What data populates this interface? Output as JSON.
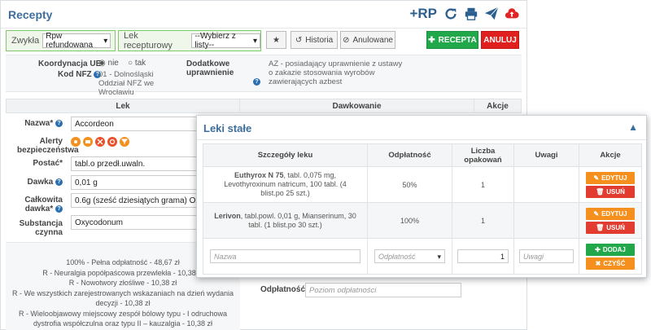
{
  "header": {
    "title": "Recepty",
    "rp_label": "+RP"
  },
  "toolbar": {
    "type_label": "Zwykła",
    "type_value": "Rpw refundowana",
    "drug_label": "Lek recepturowy",
    "drug_value": "--Wybierz z listy--",
    "history_label": "Historia",
    "cancelled_label": "Anulowane",
    "add_label": "RECEPTA",
    "cancel_label": "ANULUJ"
  },
  "info": {
    "coord_label": "Koordynacja UE",
    "radio_no": "nie",
    "radio_yes": "tak",
    "nfz_label": "Kod NFZ",
    "nfz_value": "01 - Dolnośląski Oddział NFZ we Wrocławiu",
    "extra_label": "Dodatkowe uprawnienie",
    "extra_value": "AZ - posiadający uprawnienie z ustawy o zakazie stosowania wyrobów zawierających azbest"
  },
  "table_header": {
    "drug": "Lek",
    "dosage": "Dawkowanie",
    "actions": "Akcje"
  },
  "form": {
    "name_label": "Nazwa*",
    "name_value": "Accordeon",
    "alerts_label": "Alerty bezpieczeństwa",
    "form_label": "Postać*",
    "form_value": "tabl.o przedł.uwaln.",
    "dose_label": "Dawka",
    "dose_value": "0,01 g",
    "total_label": "Całkowita dawka*",
    "total_value": "0.6g (sześć dziesiątych grama) Oxycodonum",
    "substance_label": "Substancja czynna",
    "substance_value": "Oxycodonum"
  },
  "refund_lines": [
    "100% - Pełna odpłatność - 48,67 zł",
    "R - Neuralgia popółpaścowa przewlekła - 10,38 zł",
    "R - Nowotwory złośliwe - 10,38 zł",
    "R - We wszystkich zarejestrowanych wskazaniach na dzień wydania decyzji - 10,38 zł",
    "R - Wieloobjawowy miejscowy zespół bólowy typu - I odruchowa dystrofia współczulna oraz typu II – kauzalgia - 10,38 zł"
  ],
  "payment": {
    "label": "Odpłatność",
    "placeholder": "Poziom odpłatności"
  },
  "leki_stale": {
    "title": "Leki stałe",
    "columns": [
      "Szczegóły leku",
      "Odpłatność",
      "Liczba opakowań",
      "Uwagi",
      "Akcje"
    ],
    "rows": [
      {
        "name": "Euthyrox N 75",
        "details": ", tabl. 0,075 mg, Levothyroxinum natricum, 100 tabl. (4 blist.po 25 szt.)",
        "payment": "50%",
        "count": "1",
        "notes": ""
      },
      {
        "name": "Lerivon",
        "details": ", tabl.powl. 0,01 g, Mianserinum, 30 tabl. (1 blist.po 30 szt.)",
        "payment": "100%",
        "count": "1",
        "notes": ""
      }
    ],
    "edit_label": "EDYTUJ",
    "delete_label": "USUŃ",
    "new_row": {
      "name_placeholder": "Nazwa",
      "payment_placeholder": "Odpłatność",
      "count_value": "1",
      "notes_placeholder": "Uwagi",
      "add_label": "DODAJ",
      "clear_label": "CZYŚĆ"
    }
  },
  "colors": {
    "accent": "#3c6e9e",
    "green": "#22a84b",
    "red": "#e01f1f",
    "orange": "#f5901e"
  }
}
